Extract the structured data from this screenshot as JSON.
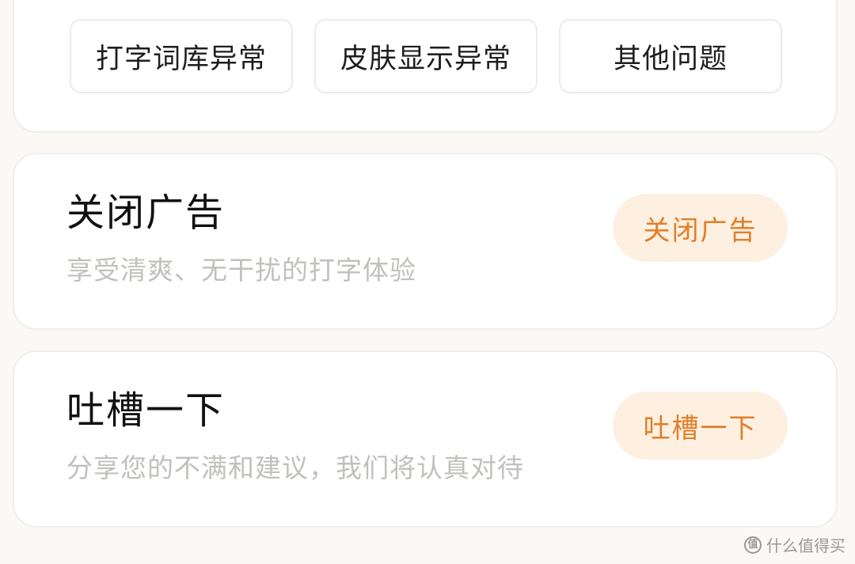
{
  "issue_chips": [
    {
      "label": "打字词库异常"
    },
    {
      "label": "皮肤显示异常"
    },
    {
      "label": "其他问题"
    }
  ],
  "close_ads": {
    "title": "关闭广告",
    "subtitle": "享受清爽、无干扰的打字体验",
    "button_label": "关闭广告"
  },
  "feedback": {
    "title": "吐槽一下",
    "subtitle": "分享您的不满和建议，我们将认真对待",
    "button_label": "吐槽一下"
  },
  "watermark": {
    "text": "什么值得买",
    "icon_glyph": "值"
  },
  "colors": {
    "accent_text": "#e17e2a",
    "accent_bg": "#fdf0e0",
    "page_bg": "#faf9f6"
  }
}
